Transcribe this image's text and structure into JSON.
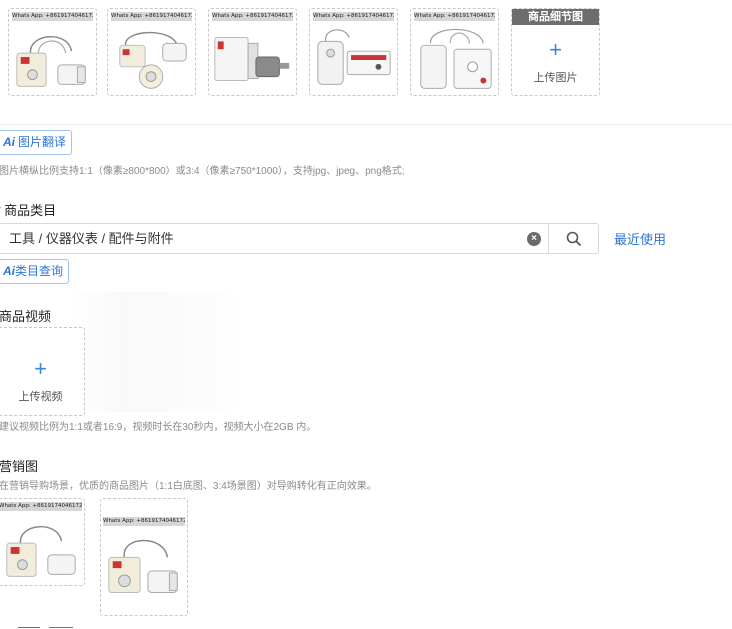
{
  "main_images": [
    {
      "watermark": "Whats App: +8619174046172",
      "product": "plug-socket-white"
    },
    {
      "watermark": "Whats App: +8619174046172",
      "product": "plug-socket-white"
    },
    {
      "watermark": "Whats App: +8619174046172",
      "product": "motor-box"
    },
    {
      "watermark": "Whats App: +8619174046172",
      "product": "motor-controller"
    },
    {
      "watermark": "Whats App: +8619174046172",
      "product": "controller-cables"
    }
  ],
  "detail_upload": {
    "header": "商品细节图",
    "plus": "+",
    "label": "上传图片"
  },
  "image_translate": {
    "ai": "Ai",
    "label": "图片翻译"
  },
  "image_hint": "图片横纵比例支持1:1（像素≥800*800）或3:4（像素≥750*1000），支持jpg、jpeg、png格式;",
  "category": {
    "required_mark": "*",
    "title": "商品类目",
    "value": "工具 / 仪器仪表 / 配件与附件",
    "clear_icon": "clear-icon",
    "search_icon": "search-icon",
    "recent_link": "最近使用"
  },
  "category_query": {
    "ai": "Ai",
    "label": "类目查询"
  },
  "video": {
    "title": "商品视频",
    "upload_plus": "+",
    "upload_label": "上传视频",
    "hint": "建议视频比例为1:1或者16:9，视频时长在30秒内，视频大小在2GB 内。"
  },
  "marketing": {
    "title": "营销图",
    "hint": "在营销导购场景，优质的商品图片（1:1白底图、3:4场景图）对导购转化有正向效果。",
    "images": [
      {
        "watermark": "Whats App: +8619174046172"
      },
      {
        "watermark": "Whats App: +8619174046172"
      }
    ]
  },
  "colors": {
    "accent": "#2e75d6",
    "border": "#d9d9d9",
    "dashed": "#c8c8c8",
    "hint": "#8a8a8a",
    "header_gray": "#6d6d6d"
  }
}
